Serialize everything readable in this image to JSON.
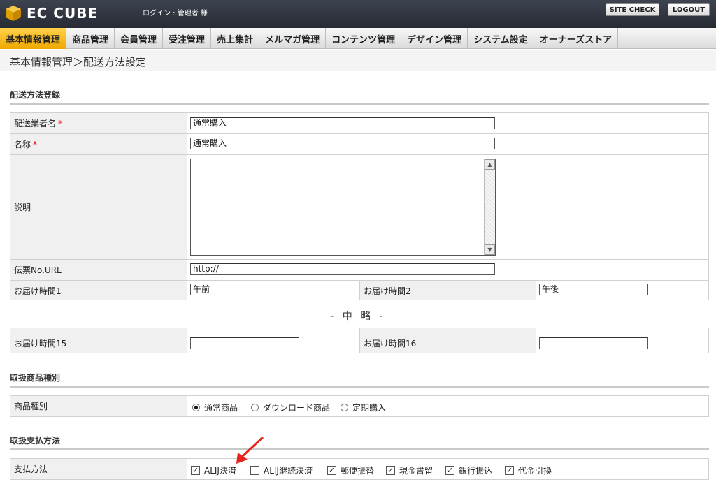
{
  "header": {
    "logo_text": "EC CUBE",
    "login_info": "ログイン : 管理者 様",
    "site_check_label": "SITE CHECK",
    "logout_label": "LOGOUT"
  },
  "nav": [
    "基本情報管理",
    "商品管理",
    "会員管理",
    "受注管理",
    "売上集計",
    "メルマガ管理",
    "コンテンツ管理",
    "デザイン管理",
    "システム設定",
    "オーナーズストア"
  ],
  "breadcrumb": "基本情報管理＞配送方法設定",
  "delivery_section": {
    "title": "配送方法登録",
    "carrier_label": "配送業者名",
    "carrier_value": "通常購入",
    "name_label": "名称",
    "name_value": "通常購入",
    "required_mark": "*",
    "description_label": "説明",
    "tracking_label": "伝票No.URL",
    "tracking_value": "http://",
    "time1_label": "お届け時間1",
    "time1_value": "午前",
    "time2_label": "お届け時間2",
    "time2_value": "午後",
    "omitted_text": "- 中 略 -",
    "time15_label": "お届け時間15",
    "time15_value": "",
    "time16_label": "お届け時間16",
    "time16_value": ""
  },
  "product_type_section": {
    "title": "取扱商品種別",
    "label": "商品種別",
    "options": [
      {
        "label": "通常商品",
        "selected": true
      },
      {
        "label": "ダウンロード商品",
        "selected": false
      },
      {
        "label": "定期購入",
        "selected": false
      }
    ]
  },
  "payment_section": {
    "title": "取扱支払方法",
    "label": "支払方法",
    "options": [
      {
        "label": "ALIJ決済",
        "checked": true
      },
      {
        "label": "ALIJ継続決済",
        "checked": false
      },
      {
        "label": "郵便振替",
        "checked": true
      },
      {
        "label": "現金書留",
        "checked": true
      },
      {
        "label": "銀行振込",
        "checked": true
      },
      {
        "label": "代金引換",
        "checked": true
      }
    ]
  },
  "colors": {
    "accent": "#f0a800",
    "header_bg": "#2d323c",
    "arrow": "#e8231a"
  }
}
